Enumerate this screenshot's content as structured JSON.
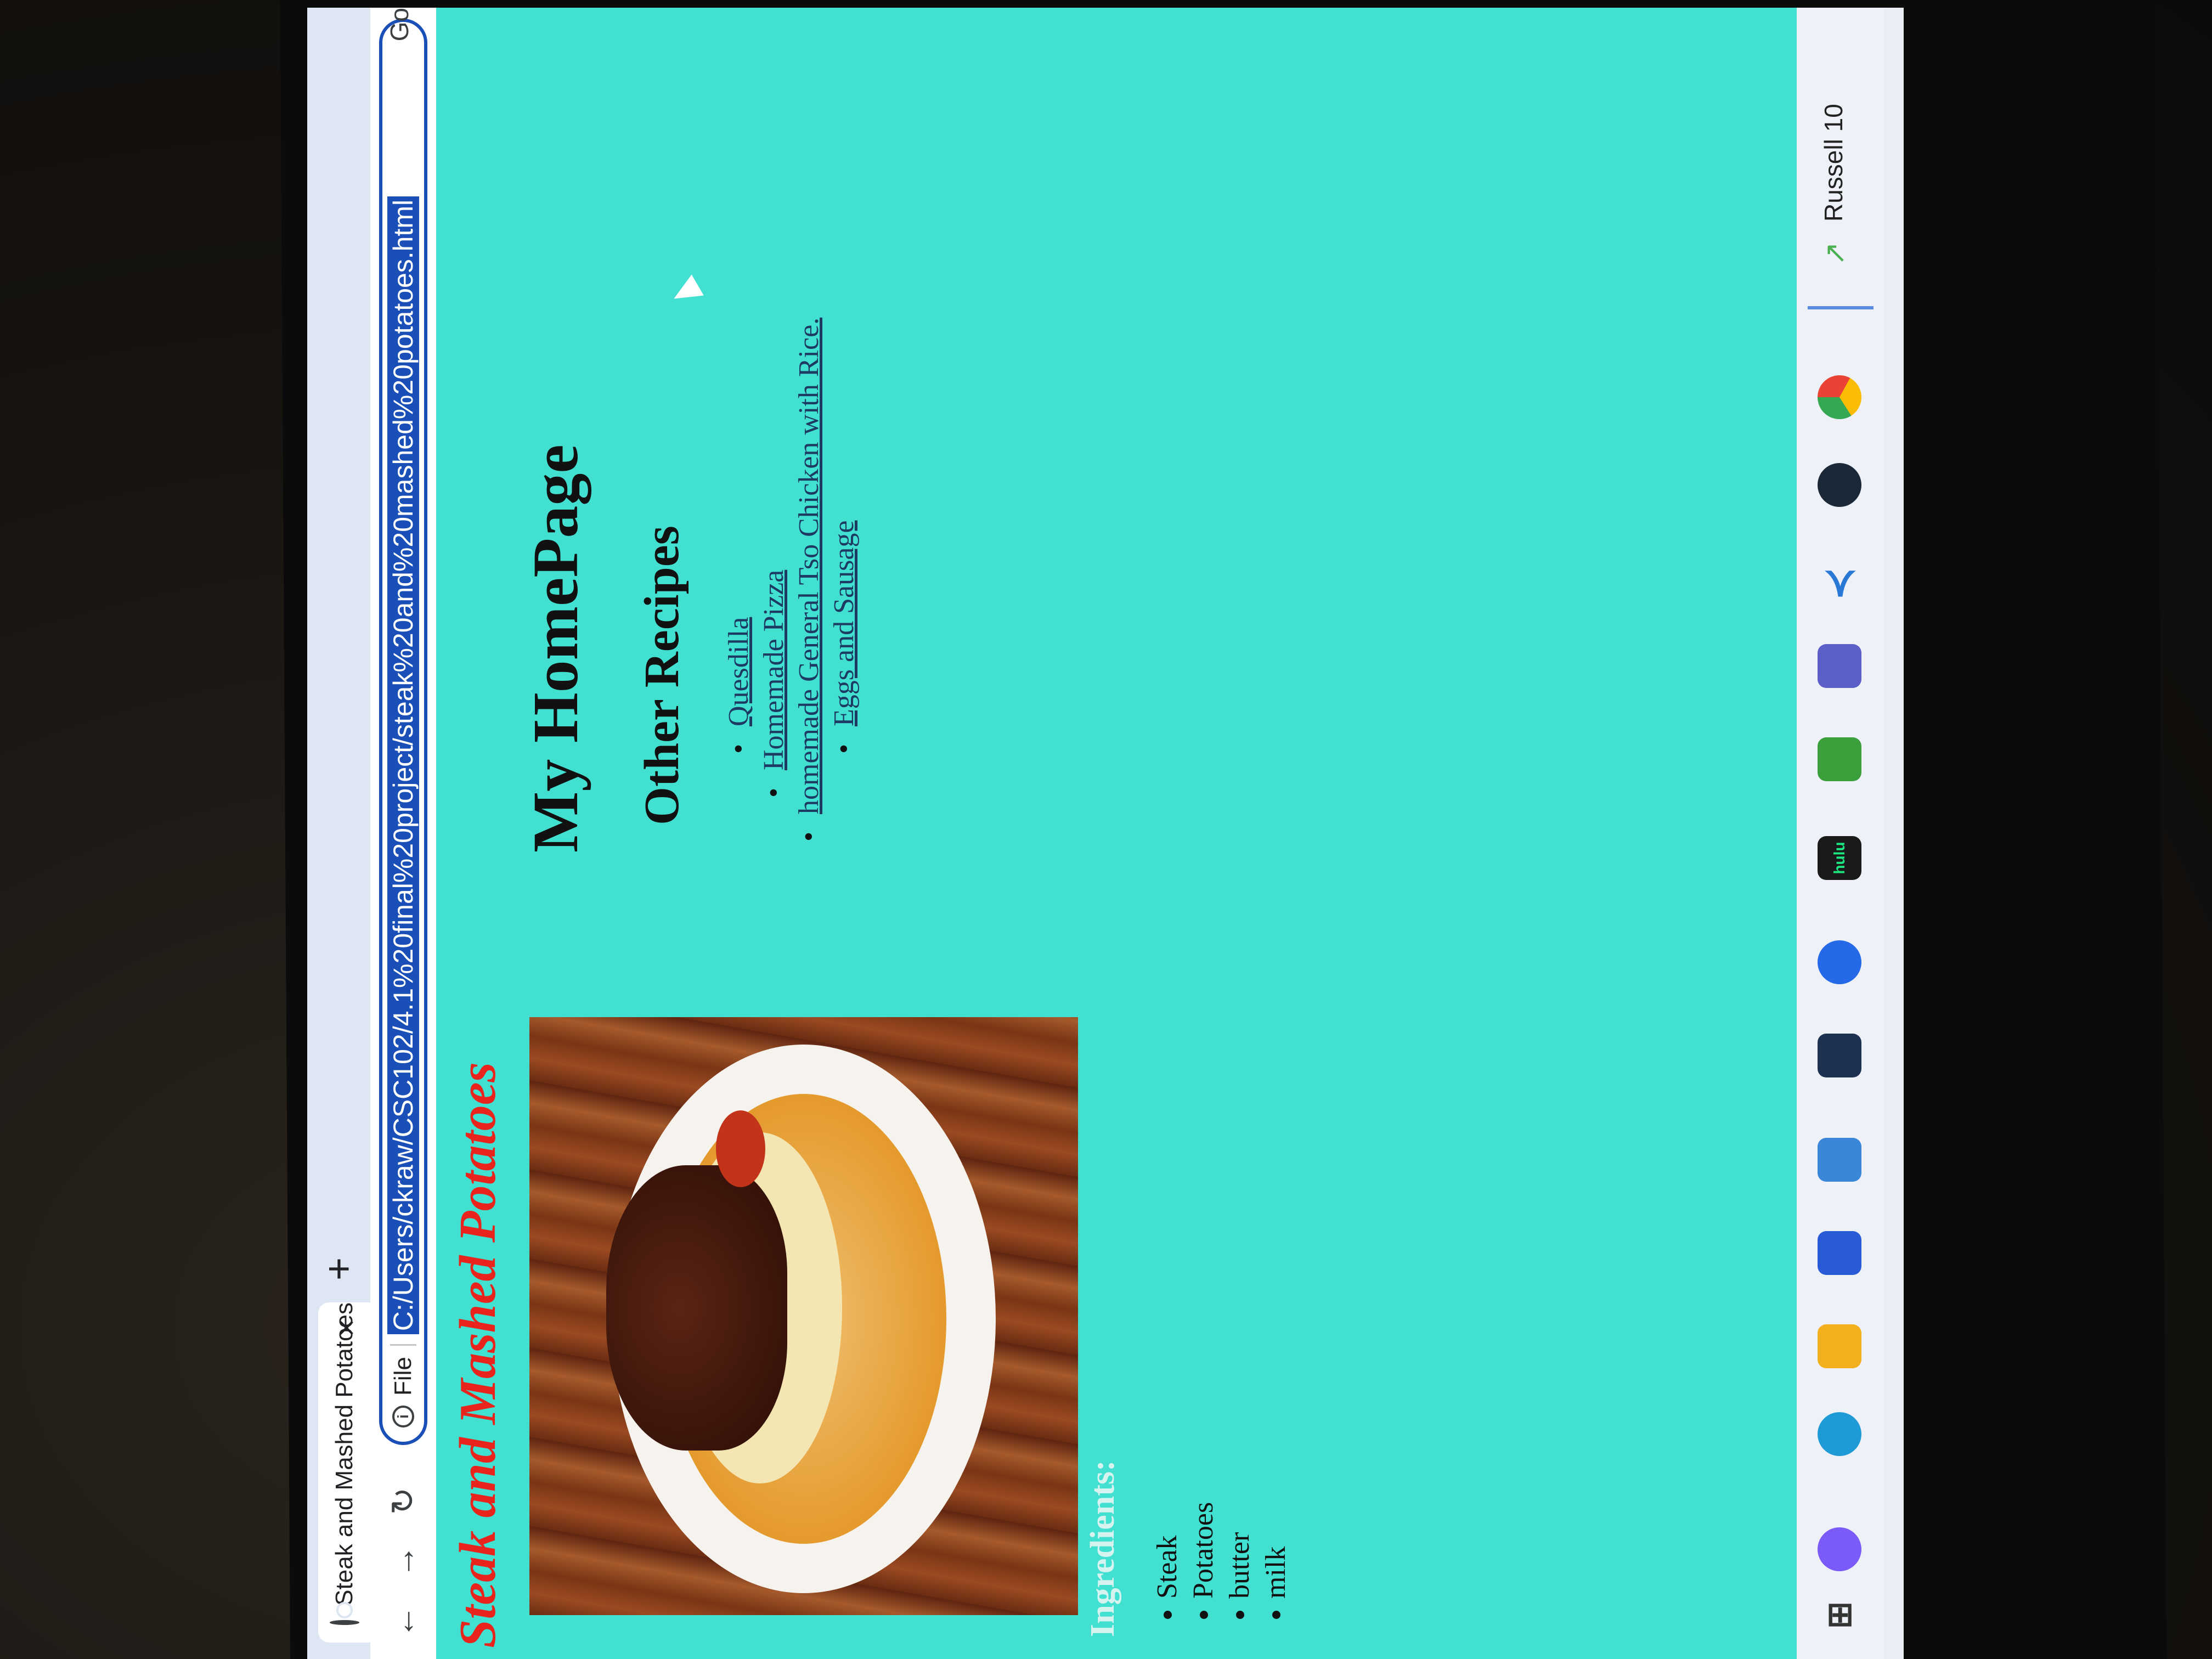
{
  "browser": {
    "tab_title": "Steak and Mashed Potatoes",
    "tab_close": "×",
    "new_tab": "+",
    "scheme_label": "File",
    "url": "C:/Users/ckraw/CSC102/4.1%20final%20project/steak%20and%20mashed%20potatoes.html",
    "back": "←",
    "forward": "→",
    "reload": "↻",
    "chevron": "›",
    "right_button": "Go"
  },
  "page": {
    "dish_title": "Steak and Mashed Potatoes",
    "ingredients_heading": "Ingredients:",
    "ingredients": [
      "Steak",
      "Potatoes",
      "butter",
      "milk"
    ],
    "home_title": "My HomePage",
    "other_title": "Other Recipes",
    "recipes": [
      "Quesdilla",
      "Homemade Pizza",
      "homemade General Tso Chicken with Rice.",
      "Eggs and Sausage"
    ],
    "colors": {
      "background": "#42e0d0",
      "dish_title": "#e8241d",
      "link": "#1d3a63"
    }
  },
  "taskbar": {
    "hulu_label": "hulu",
    "status_text": "Russell 10"
  }
}
